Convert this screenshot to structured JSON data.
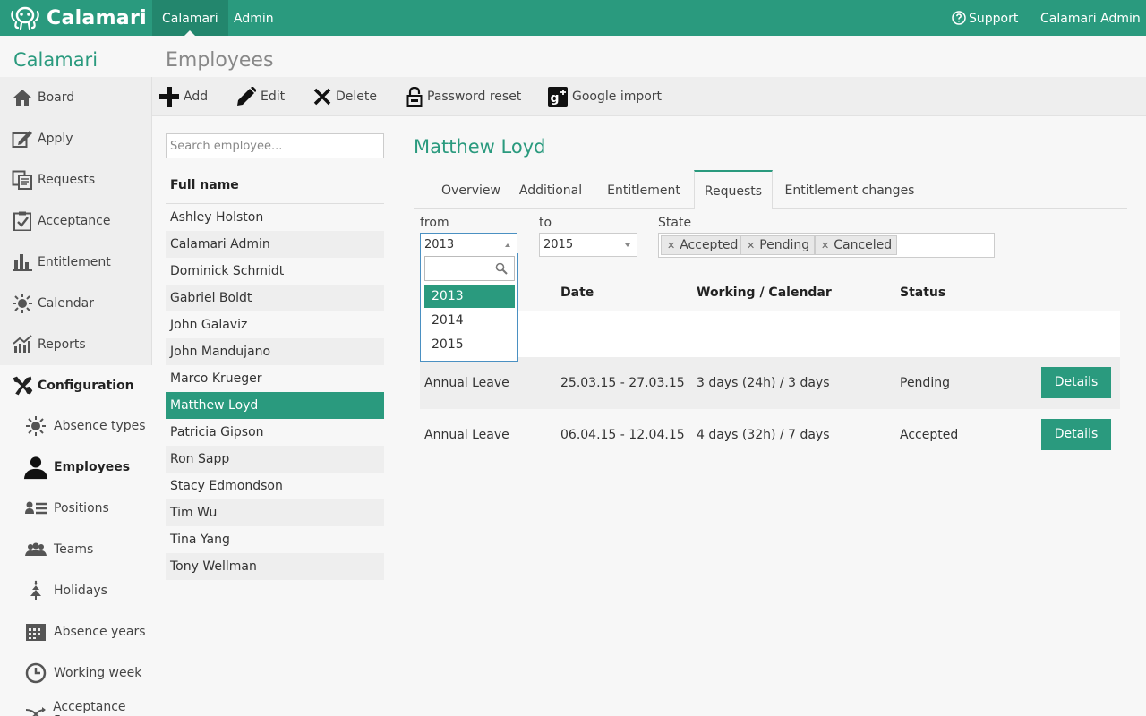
{
  "topbar": {
    "logo": "Calamari",
    "nav": [
      {
        "label": "Calamari",
        "active": true
      },
      {
        "label": "Admin",
        "active": false
      }
    ],
    "support": "Support",
    "user": "Calamari Admin"
  },
  "sidebar": {
    "brand": "Calamari",
    "items": [
      {
        "label": "Board",
        "icon": "home-icon"
      },
      {
        "label": "Apply",
        "icon": "edit-icon"
      },
      {
        "label": "Requests",
        "icon": "requests-icon"
      },
      {
        "label": "Acceptance",
        "icon": "check-clipboard-icon"
      },
      {
        "label": "Entitlement",
        "icon": "bar-chart-icon"
      },
      {
        "label": "Calendar",
        "icon": "sun-icon"
      },
      {
        "label": "Reports",
        "icon": "line-chart-icon"
      }
    ],
    "config_label": "Configuration",
    "config_items": [
      {
        "label": "Absence types",
        "icon": "sun-icon"
      },
      {
        "label": "Employees",
        "icon": "person-icon",
        "active": true
      },
      {
        "label": "Positions",
        "icon": "id-card-icon"
      },
      {
        "label": "Teams",
        "icon": "team-icon"
      },
      {
        "label": "Holidays",
        "icon": "tree-icon"
      },
      {
        "label": "Absence years",
        "icon": "calendar-grid-icon"
      },
      {
        "label": "Working week",
        "icon": "clock-icon"
      },
      {
        "label": "Acceptance flow",
        "icon": "flow-icon"
      }
    ]
  },
  "page": {
    "title": "Employees"
  },
  "toolbar": {
    "add": "Add",
    "edit": "Edit",
    "delete": "Delete",
    "password_reset": "Password reset",
    "google_import": "Google import"
  },
  "employees": {
    "search_placeholder": "Search employee...",
    "header": "Full name",
    "list": [
      "Ashley Holston",
      "Calamari Admin",
      "Dominick Schmidt",
      "Gabriel Boldt",
      "John Galaviz",
      "John Mandujano",
      "Marco Krueger",
      "Matthew Loyd",
      "Patricia Gipson",
      "Ron Sapp",
      "Stacy Edmondson",
      "Tim Wu",
      "Tina Yang",
      "Tony Wellman"
    ],
    "selected": "Matthew Loyd"
  },
  "detail": {
    "name": "Matthew Loyd",
    "tabs": [
      "Overview",
      "Additional",
      "Entitlement",
      "Requests",
      "Entitlement changes"
    ],
    "active_tab": "Requests",
    "filters": {
      "from_label": "from",
      "from_value": "2013",
      "to_label": "to",
      "to_value": "2015",
      "state_label": "State",
      "states": [
        "Accepted",
        "Pending",
        "Canceled"
      ]
    },
    "dropdown": {
      "options": [
        "2013",
        "2014",
        "2015"
      ],
      "highlighted": "2013"
    },
    "columns": [
      "Date",
      "Working / Calendar",
      "Status"
    ],
    "requests": [
      {
        "type": "Annual Leave",
        "date": "25.03.15 - 27.03.15",
        "working": "3 days (24h) / 3 days",
        "status": "Pending",
        "action": "Details"
      },
      {
        "type": "Annual Leave",
        "date": "06.04.15 - 12.04.15",
        "working": "4 days (32h) / 7 days",
        "status": "Accepted",
        "action": "Details"
      }
    ]
  },
  "colors": {
    "accent": "#2a9a7e",
    "accent_dark": "#23866d",
    "background": "#f7f7f7"
  }
}
